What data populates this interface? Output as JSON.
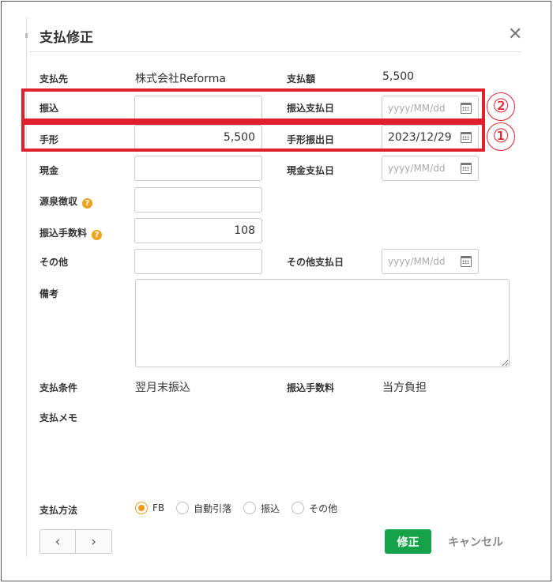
{
  "dialog": {
    "title": "支払修正",
    "close_icon": "close-icon"
  },
  "fields": {
    "payee_label": "支払先",
    "payee_value": "株式会社Reforma",
    "amount_label": "支払額",
    "amount_value": "5,500",
    "transfer_label": "振込",
    "transfer_value": "",
    "transfer_date_label": "振込支払日",
    "transfer_date_value": "",
    "note_label": "手形",
    "note_value": "5,500",
    "note_date_label": "手形振出日",
    "note_date_value": "2023/12/29",
    "cash_label": "現金",
    "cash_value": "",
    "cash_date_label": "現金支払日",
    "cash_date_value": "",
    "withholding_label": "源泉徴収",
    "withholding_value": "",
    "fee_label": "振込手数料",
    "fee_value": "108",
    "other_label": "その他",
    "other_value": "",
    "other_date_label": "その他支払日",
    "other_date_value": "",
    "remarks_label": "備考",
    "remarks_value": "",
    "date_placeholder": "yyyy/MM/dd",
    "help_icon": "?"
  },
  "conditions": {
    "pay_terms_label": "支払条件",
    "pay_terms_value": "翌月末振込",
    "fee_burden_label": "振込手数料",
    "fee_burden_value": "当方負担",
    "memo_label": "支払メモ"
  },
  "payment_method": {
    "label": "支払方法",
    "options": [
      "FB",
      "自動引落",
      "振込",
      "その他"
    ],
    "selected": "FB"
  },
  "annotations": {
    "marker_1": "①",
    "marker_2": "②",
    "color": "#e0202c"
  },
  "footer": {
    "prev_icon": "‹",
    "next_icon": "›",
    "submit_label": "修正",
    "cancel_label": "キャンセル",
    "submit_color": "#16a24a",
    "radio_color": "#f19a1a"
  }
}
